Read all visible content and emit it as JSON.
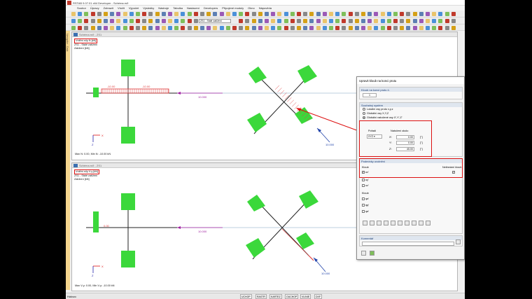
{
  "window": {
    "title": "RSTAB 9.07.01 x64 Developer - Schéma.rs9"
  },
  "menu": [
    "Soubor",
    "Úpravy",
    "Zobrazit",
    "Vložit",
    "Výpočet",
    "Výsledky",
    "Nástroje",
    "Tabulka",
    "Nastavení",
    "Developers",
    "Připojené moduly",
    "Okno",
    "Nápověda"
  ],
  "toolbar": {
    "loadcase": "ZS1 - Stálé zatížení"
  },
  "left_panel": {
    "label": "Navigátor - Data"
  },
  "view_top": {
    "title": "Schéma.rs9 - ZS1",
    "result_label": "Vnitřní síly N [kN]",
    "case": "ZS1 - Stálé zatížení",
    "load": "Zatížení [kN]",
    "val1": "-10.00",
    "val2": "-10.00",
    "val3": "10.000",
    "val4": "10.000",
    "axis_x": "X",
    "axis_z": "Z",
    "summary": "Max N: 0.00, Min N: -10.00 kN"
  },
  "view_bottom": {
    "title": "Schéma.rs9 - ZS1",
    "result_label": "Vnitřní síly V-y [kN]",
    "case": "ZS1 - Stálé zatížení",
    "load": "Zatížení [kN]",
    "val1": "0.00",
    "val3": "10.000",
    "val4": "10.000",
    "axis_x": "X",
    "axis_z": "Z",
    "summary": "Max V-y: 0.00, Min V-y: -10.00 kN"
  },
  "dialog": {
    "title": "Upravit kloub na konci prutu",
    "sec1": "Kloub na konci prutu č.",
    "sec1_value": "1",
    "sec2": "Souřadný systém",
    "radio1": "Lokální osy prutu x,y,z",
    "radio2": "Globální osy X,Y,Z",
    "radio3": "Globální natočené osy X',Y',Z'",
    "order_label": "Pořadí",
    "order_value": "XYZ",
    "rot_label": "Natočení okolo",
    "xr": "X':",
    "yr": "Y':",
    "zr": "Z':",
    "xv": "0.00",
    "yv": "0.00",
    "zv": "45.00",
    "unit": "[°]",
    "sec3": "Podmínky uvolnění",
    "col1": "Kloub",
    "col2": "Nelineární kloub",
    "uX": "ux'",
    "uY": "uy'",
    "uZ": "uz'",
    "sec4": "Kloub",
    "fX": "φx'",
    "fY": "φy'",
    "fZ": "φz'",
    "sec5": "Komentář"
  },
  "status": {
    "left": "Hotovo",
    "buttons": [
      "UCHOP",
      "RASTR",
      "KARTEZ",
      "OUCHOP",
      "VLINIE",
      "DXF"
    ]
  },
  "colors": {
    "support": "#3bd83b",
    "diagram": "#e04040",
    "load": "#a020a0",
    "highlight": "#dd1111"
  }
}
